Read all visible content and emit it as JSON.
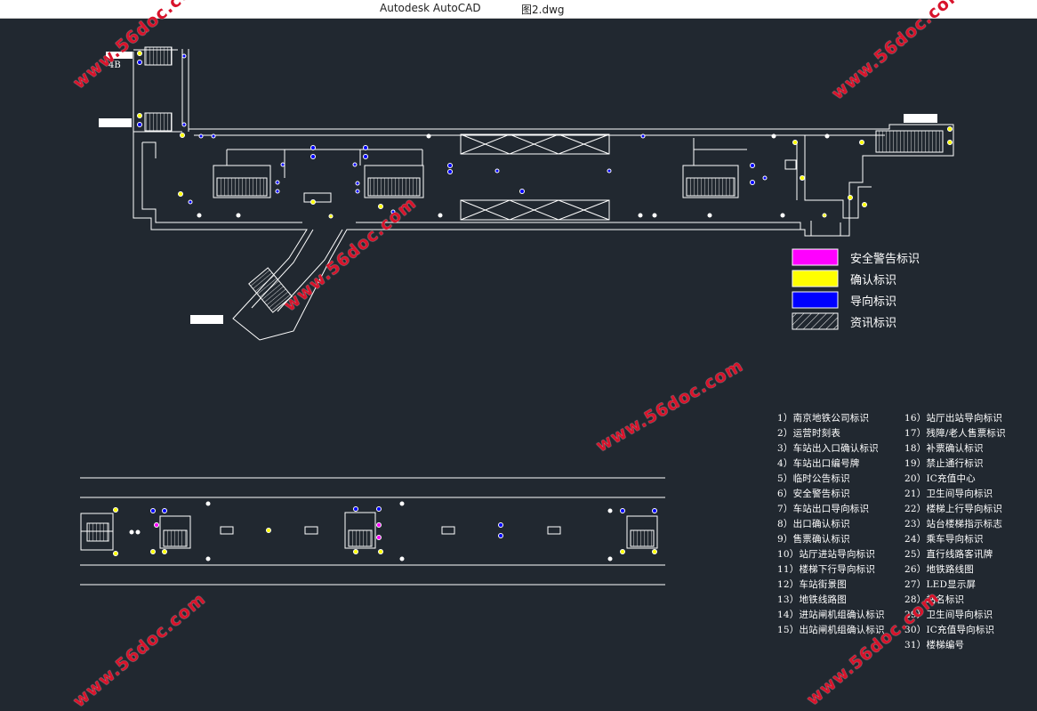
{
  "window": {
    "app_title": "Autodesk AutoCAD",
    "file_name": "图2.dwg"
  },
  "drawing": {
    "exit_label": "4B"
  },
  "legend": {
    "items": [
      {
        "label": "安全警告标识",
        "color": "#ff00ff",
        "pattern": "solid"
      },
      {
        "label": "确认标识",
        "color": "#ffff00",
        "pattern": "solid"
      },
      {
        "label": "导向标识",
        "color": "#0000ff",
        "pattern": "solid"
      },
      {
        "label": "资讯标识",
        "color": "#ffffff",
        "pattern": "hatch"
      }
    ]
  },
  "notes": {
    "left": [
      "1）南京地铁公司标识",
      "2）运营时刻表",
      "3）车站出入口确认标识",
      "4）车站出口编号牌",
      "5）临时公告标识",
      "6）安全警告标识",
      "7）车站出口导向标识",
      "8）出口确认标识",
      "9）售票确认标识",
      "10）站厅进站导向标识",
      "11）楼梯下行导向标识",
      "12）车站街景图",
      "13）地铁线路图",
      "14）进站闸机组确认标识",
      "15）出站闸机组确认标识"
    ],
    "right": [
      "16）站厅出站导向标识",
      "17）残障/老人售票标识",
      "18）补票确认标识",
      "19）禁止通行标识",
      "20）IC充值中心",
      "21）卫生间导向标识",
      "22）楼梯上行导向标识",
      "23）站台楼梯指示标志",
      "24）乘车导向标识",
      "25）直行线路客讯牌",
      "26）地铁路线图",
      "27）LED显示屏",
      "28）站名标识",
      "29）卫生间导向标识",
      "30）IC充值导向标识",
      "31）楼梯编号"
    ]
  },
  "watermark": {
    "text": "www.56doc.com",
    "color": "#d8132b"
  }
}
